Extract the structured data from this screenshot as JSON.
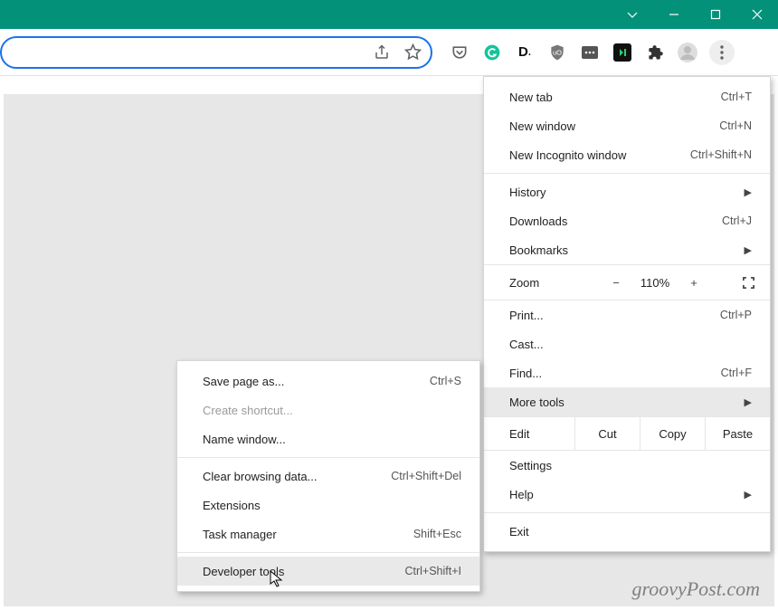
{
  "window_controls": {
    "chevron": "⌄",
    "min": "—",
    "max": "▢",
    "close": "✕"
  },
  "omnibox": {
    "share": "share-icon",
    "star": "star-icon"
  },
  "extensions": [
    "pocket",
    "grammarly",
    "dictionary",
    "ublock",
    "viewer",
    "video",
    "puzzle",
    "avatar"
  ],
  "menu": {
    "new_tab": {
      "label": "New tab",
      "shortcut": "Ctrl+T"
    },
    "new_window": {
      "label": "New window",
      "shortcut": "Ctrl+N"
    },
    "new_incognito": {
      "label": "New Incognito window",
      "shortcut": "Ctrl+Shift+N"
    },
    "history": {
      "label": "History"
    },
    "downloads": {
      "label": "Downloads",
      "shortcut": "Ctrl+J"
    },
    "bookmarks": {
      "label": "Bookmarks"
    },
    "zoom": {
      "label": "Zoom",
      "value": "110%"
    },
    "print": {
      "label": "Print...",
      "shortcut": "Ctrl+P"
    },
    "cast": {
      "label": "Cast..."
    },
    "find": {
      "label": "Find...",
      "shortcut": "Ctrl+F"
    },
    "more_tools": {
      "label": "More tools"
    },
    "edit": {
      "label": "Edit",
      "cut": "Cut",
      "copy": "Copy",
      "paste": "Paste"
    },
    "settings": {
      "label": "Settings"
    },
    "help": {
      "label": "Help"
    },
    "exit": {
      "label": "Exit"
    }
  },
  "submenu": {
    "save_page": {
      "label": "Save page as...",
      "shortcut": "Ctrl+S"
    },
    "create_shortcut": {
      "label": "Create shortcut..."
    },
    "name_window": {
      "label": "Name window..."
    },
    "clear_data": {
      "label": "Clear browsing data...",
      "shortcut": "Ctrl+Shift+Del"
    },
    "extensions": {
      "label": "Extensions"
    },
    "task_manager": {
      "label": "Task manager",
      "shortcut": "Shift+Esc"
    },
    "dev_tools": {
      "label": "Developer tools",
      "shortcut": "Ctrl+Shift+I"
    }
  },
  "watermark": "groovyPost.com"
}
